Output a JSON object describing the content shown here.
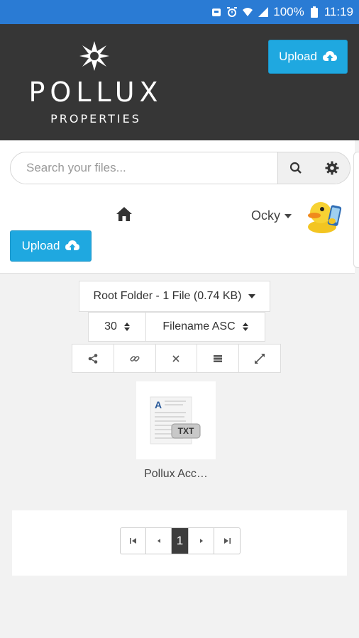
{
  "status_bar": {
    "battery": "100%",
    "time": "11:19"
  },
  "header": {
    "logo_name": "POLLUX",
    "logo_sub": "PROPERTIES",
    "upload_label": "Upload"
  },
  "toolbar": {
    "search_placeholder": "Search your files...",
    "user_name": "Ocky",
    "upload_label": "Upload"
  },
  "controls": {
    "folder_label": "Root Folder - 1 File (0.74 KB)",
    "per_page": "30",
    "sort": "Filename ASC"
  },
  "files": [
    {
      "name": "Pollux Acc…",
      "type": "TXT"
    }
  ],
  "pagination": {
    "current": "1"
  },
  "colors": {
    "header": "#363636",
    "accent": "#1fa8e0",
    "status_bar": "#2a7bd4"
  }
}
